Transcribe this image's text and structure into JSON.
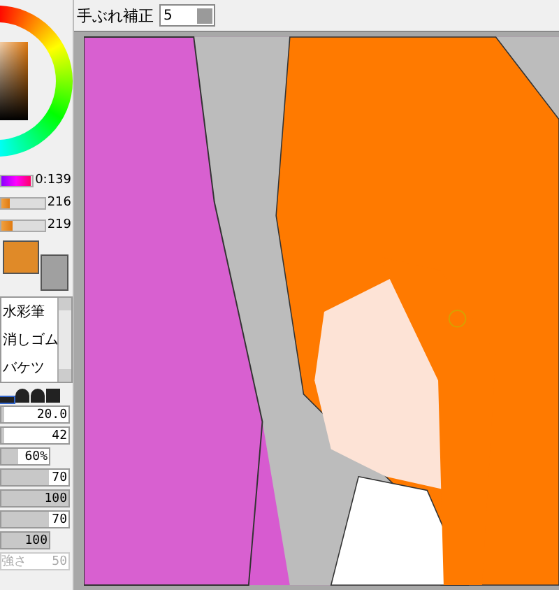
{
  "toolbar": {
    "label": "手ぶれ補正",
    "stabilizer": "5"
  },
  "color_sliders": [
    {
      "kind": "hue",
      "level": 0.95,
      "reading": "0:139"
    },
    {
      "kind": "orange",
      "level": 0.2,
      "reading": "216"
    },
    {
      "kind": "orange",
      "level": 0.25,
      "reading": "219"
    }
  ],
  "swatches": [
    {
      "kind": "foreground",
      "color": "#e08a28"
    },
    {
      "kind": "background",
      "color": "#a0a0a0"
    }
  ],
  "tools": [
    {
      "label": "水彩筆",
      "selected": false
    },
    {
      "label": "消しゴム",
      "selected": false
    },
    {
      "label": "バケツ",
      "selected": false
    }
  ],
  "brush_shapes": [
    {
      "kind": "flat",
      "selected": true
    },
    {
      "kind": "dome",
      "selected": false
    },
    {
      "kind": "dome",
      "selected": false
    },
    {
      "kind": "square",
      "selected": false
    }
  ],
  "brush_settings": [
    {
      "kind": "wide",
      "level": 0.05,
      "reading": "20.0",
      "disabled": false
    },
    {
      "kind": "wide",
      "level": 0.05,
      "reading": "42",
      "disabled": false
    },
    {
      "kind": "short",
      "level": 0.35,
      "reading": "60%",
      "disabled": false
    },
    {
      "kind": "wide",
      "level": 0.7,
      "reading": "70",
      "disabled": false
    },
    {
      "kind": "wide",
      "level": 1,
      "reading": "100",
      "disabled": false
    },
    {
      "kind": "wide",
      "level": 0.7,
      "reading": "70",
      "disabled": false
    },
    {
      "kind": "short",
      "level": 1,
      "reading": "100",
      "disabled": false
    },
    {
      "kind": "wide",
      "label": "強さ",
      "reading": "50",
      "disabled": true
    }
  ]
}
